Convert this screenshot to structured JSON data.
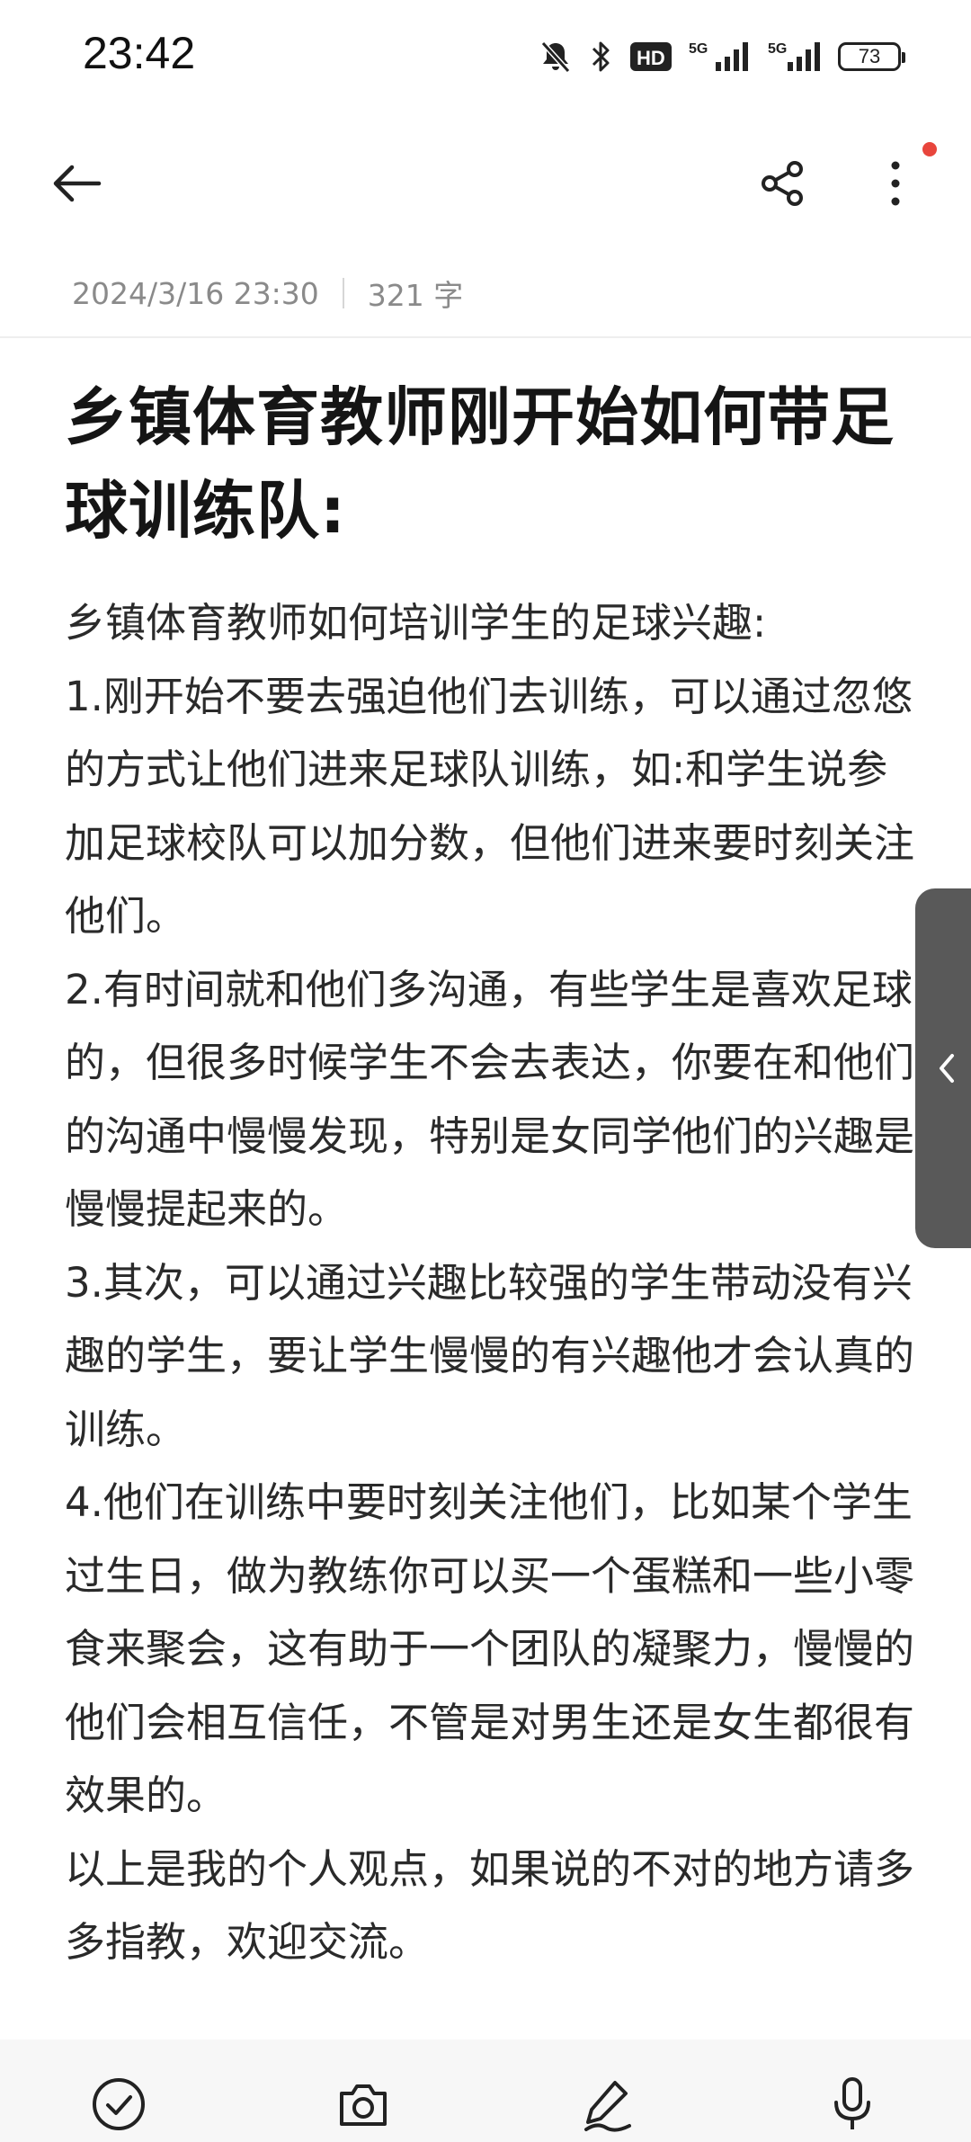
{
  "status_bar": {
    "time": "23:42",
    "hd_label": "HD",
    "net1": "5G",
    "net2": "5G",
    "battery": "73",
    "icons": [
      "mute-bell-icon",
      "bluetooth-icon",
      "hd-voice-icon",
      "signal-5g-icon",
      "signal-5g-icon",
      "battery-icon"
    ]
  },
  "toolbar": {
    "icons": [
      "back-arrow-icon",
      "share-icon",
      "more-vertical-icon"
    ]
  },
  "meta": {
    "datetime": "2024/3/16 23:30",
    "word_count": "321 字"
  },
  "note": {
    "title": "乡镇体育教师刚开始如何带足球训练队:",
    "paragraphs": [
      "乡镇体育教师如何培训学生的足球兴趣:",
      "1.刚开始不要去强迫他们去训练，可以通过忽悠的方式让他们进来足球队训练，如:和学生说参加足球校队可以加分数，但他们进来要时刻关注他们。",
      "2.有时间就和他们多沟通，有些学生是喜欢足球的，但很多时候学生不会去表达，你要在和他们的沟通中慢慢发现，特别是女同学他们的兴趣是慢慢提起来的。",
      "3.其次，可以通过兴趣比较强的学生带动没有兴趣的学生，要让学生慢慢的有兴趣他才会认真的训练。",
      "4.他们在训练中要时刻关注他们，比如某个学生过生日，做为教练你可以买一个蛋糕和一些小零食来聚会，这有助于一个团队的凝聚力，慢慢的他们会相互信任，不管是对男生还是女生都很有效果的。",
      "以上是我的个人观点，如果说的不对的地方请多多指教，欢迎交流。"
    ]
  },
  "bottom_bar": {
    "icons": [
      "checklist-icon",
      "camera-icon",
      "pen-icon",
      "microphone-icon"
    ]
  },
  "colors": {
    "notification_dot": "#e8453c",
    "side_handle": "#595959"
  }
}
